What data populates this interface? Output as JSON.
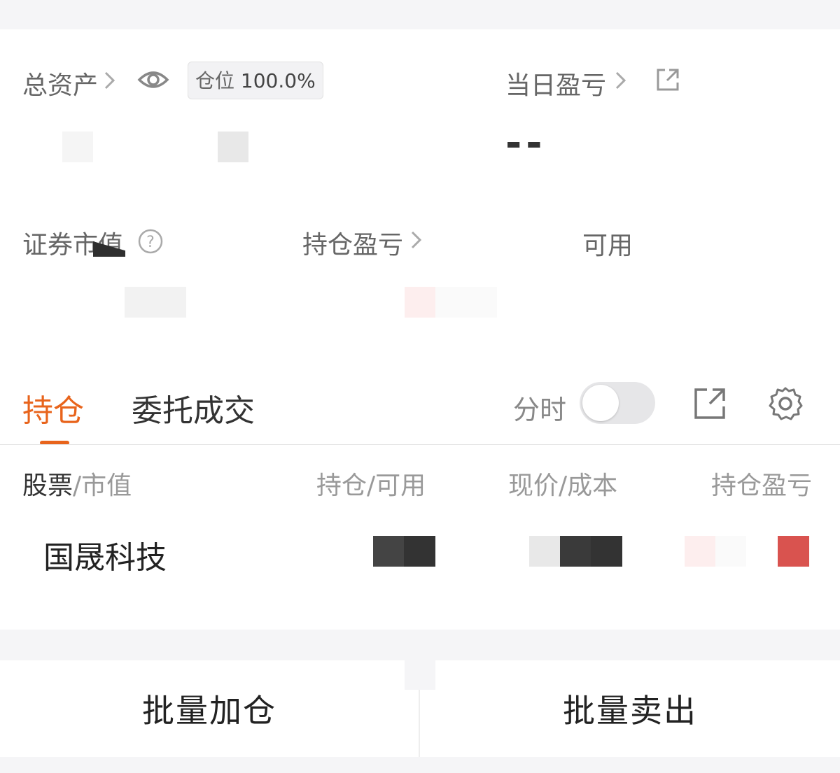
{
  "summary": {
    "total_assets_label": "总资产",
    "position_badge_label": "仓位",
    "position_badge_value": "100.0%",
    "daily_pnl_label": "当日盈亏",
    "daily_pnl_value": "--",
    "securities_value_label": "证券市值",
    "holding_pnl_label": "持仓盈亏",
    "available_label": "可用"
  },
  "tabs": [
    {
      "label": "持仓",
      "active": true
    },
    {
      "label": "委托成交",
      "active": false
    }
  ],
  "toolbar": {
    "timeshare_label": "分时",
    "timeshare_on": false
  },
  "table": {
    "headers": {
      "stock_primary": "股票",
      "stock_secondary": "/市值",
      "holding": "持仓/可用",
      "price": "现价/成本",
      "pnl": "持仓盈亏"
    },
    "rows": [
      {
        "name": "国晟科技"
      }
    ]
  },
  "actions": {
    "batch_add": "批量加仓",
    "batch_sell": "批量卖出"
  },
  "colors": {
    "accent": "#e8641c",
    "loss_red": "#d9534f"
  }
}
